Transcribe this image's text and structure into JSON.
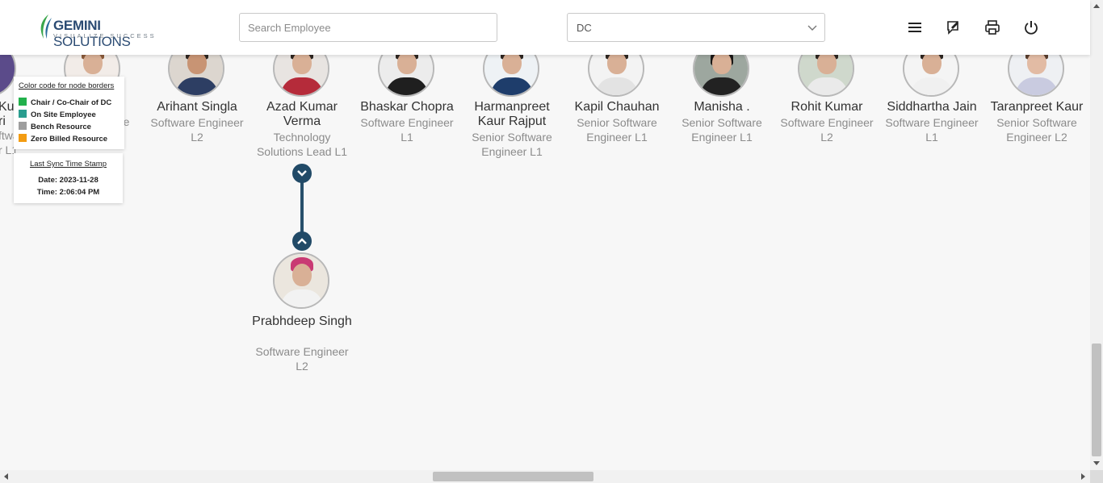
{
  "header": {
    "logo_name": "GEMINI SOLUTIONS",
    "logo_brand": "GEMINI",
    "logo_rest": " SOLUTIONS",
    "logo_tagline": "VISUALIZE SUCCESS",
    "search_placeholder": "Search Employee",
    "department_value": "DC",
    "icons": [
      "menu-icon",
      "feedback-icon",
      "print-icon",
      "power-icon"
    ]
  },
  "nodes": [
    {
      "name": "Kur",
      "role": "Softwa"
    },
    {
      "name": "a",
      "role": "re"
    },
    {
      "name": "Arihant Singla",
      "role": "Software Engineer L2"
    },
    {
      "name": "Azad Kumar Verma",
      "role": "Technology Solutions Lead L1"
    },
    {
      "name": "Bhaskar Chopra",
      "role": "Software Engineer L1"
    },
    {
      "name": "Harmanpreet Kaur Rajput",
      "role": "Senior Software Engineer L1"
    },
    {
      "name": "Kapil Chauhan",
      "role": "Senior Software Engineer L1"
    },
    {
      "name": "Manisha .",
      "role": "Senior Software Engineer L1"
    },
    {
      "name": "Rohit Kumar",
      "role": "Software Engineer L2"
    },
    {
      "name": "Siddhartha Jain",
      "role": "Software Engineer L1"
    },
    {
      "name": "Taranpreet Kaur",
      "role": "Senior Software Engineer L2"
    }
  ],
  "child_node": {
    "name": "Prabhdeep Singh",
    "role": "Software Engineer L2"
  },
  "partial_left": {
    "line1": "Kur",
    "line2": "ri",
    "line3": "ftwa",
    "line4": "r L1"
  },
  "legend": {
    "title": "Color code for node borders",
    "items": [
      {
        "label": "Chair / Co-Chair of DC",
        "color": "#22b14c"
      },
      {
        "label": "On Site Employee",
        "color": "#2a9d8f"
      },
      {
        "label": "Bench Resource",
        "color": "#9e9e9e"
      },
      {
        "label": "Zero Billed Resource",
        "color": "#f39c12"
      }
    ]
  },
  "sync": {
    "title": "Last Sync Time Stamp",
    "date": "Date: 2023-11-28",
    "time": "Time: 2:06:04 PM"
  },
  "colors": {
    "accent": "#214a67",
    "brand": "#2b4b73"
  }
}
